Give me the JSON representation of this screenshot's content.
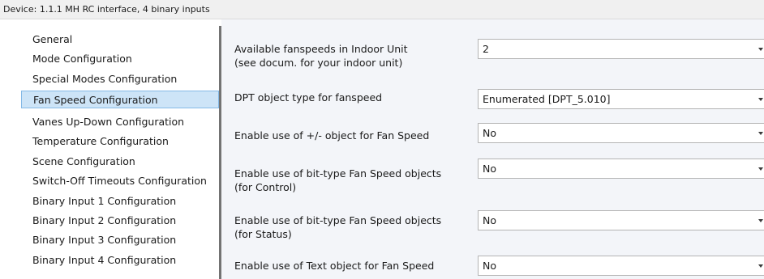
{
  "window": {
    "title": "Device: 1.1.1  MH RC interface, 4 binary inputs"
  },
  "sidebar": {
    "items": [
      {
        "label": "General"
      },
      {
        "label": "Mode Configuration"
      },
      {
        "label": "Special Modes Configuration"
      },
      {
        "label": "Fan Speed Configuration",
        "selected": true
      },
      {
        "label": "Vanes Up-Down Configuration"
      },
      {
        "label": "Temperature Configuration"
      },
      {
        "label": "Scene Configuration"
      },
      {
        "label": "Switch-Off Timeouts Configuration"
      },
      {
        "label": "Binary Input 1 Configuration"
      },
      {
        "label": "Binary Input 2 Configuration"
      },
      {
        "label": "Binary Input 3 Configuration"
      },
      {
        "label": "Binary Input 4 Configuration"
      }
    ]
  },
  "params": [
    {
      "label_line1": "Available fanspeeds in Indoor Unit",
      "label_line2": "(see docum. for your indoor unit)",
      "value": "2"
    },
    {
      "label_line1": "DPT object type for fanspeed",
      "value": "Enumerated [DPT_5.010]"
    },
    {
      "label_line1": "Enable use of +/- object for Fan Speed",
      "value": "No"
    },
    {
      "label_line1": "Enable use of bit-type Fan Speed objects",
      "label_line2": "(for Control)",
      "value": "No"
    },
    {
      "label_line1": "Enable use of bit-type Fan Speed objects",
      "label_line2": "(for Status)",
      "value": "No"
    },
    {
      "label_line1": "Enable use of Text object for Fan Speed",
      "value": "No"
    }
  ],
  "colors": {
    "selection_bg": "#cde4f7",
    "selection_border": "#84b9e6",
    "panel_bg": "#f3f5f9",
    "splitter": "#737373"
  },
  "icons": {
    "dropdown_arrow": "chevron-down-icon"
  }
}
